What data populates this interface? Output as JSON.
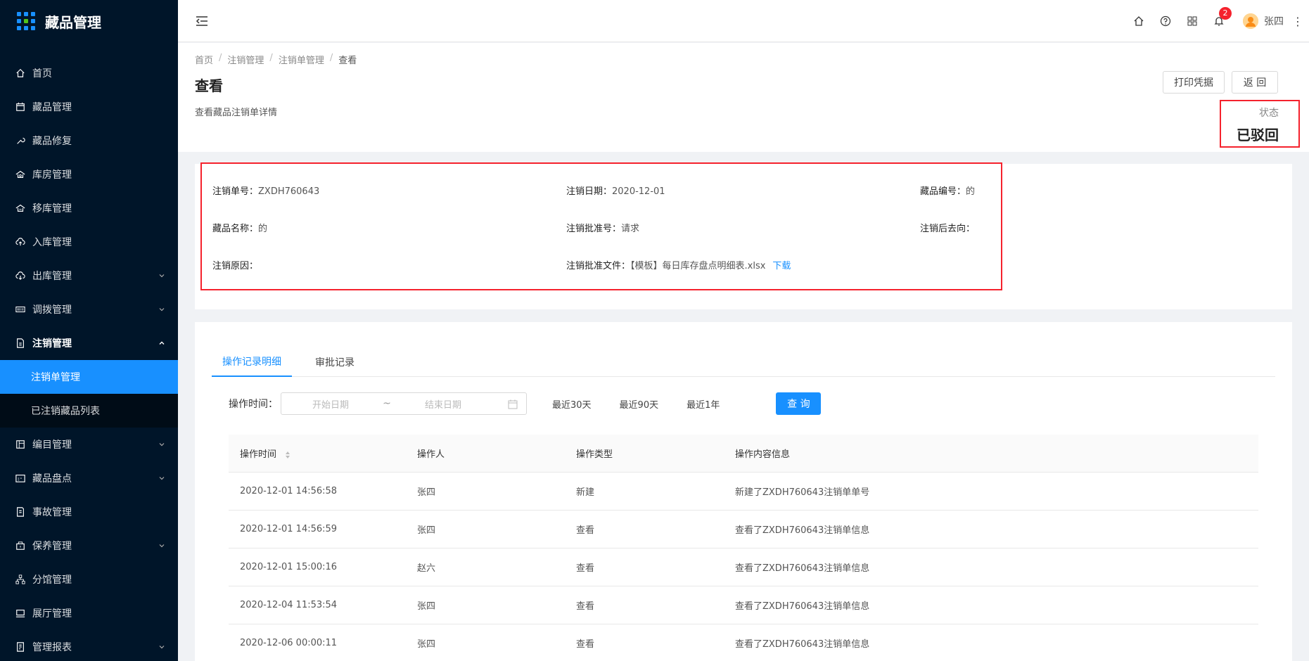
{
  "app": {
    "title": "藏品管理"
  },
  "sidebar": {
    "items": [
      {
        "label": "首页",
        "icon": "home-icon"
      },
      {
        "label": "藏品管理",
        "icon": "calendar-icon"
      },
      {
        "label": "藏品修复",
        "icon": "wrench-icon"
      },
      {
        "label": "库房管理",
        "icon": "warehouse-icon"
      },
      {
        "label": "移库管理",
        "icon": "transfer-icon"
      },
      {
        "label": "入库管理",
        "icon": "cloud-upload-icon"
      },
      {
        "label": "出库管理",
        "icon": "cloud-download-icon"
      },
      {
        "label": "调拨管理",
        "icon": "barcode-icon"
      },
      {
        "label": "注销管理",
        "icon": "file-icon"
      },
      {
        "label": "编目管理",
        "icon": "catalog-icon"
      },
      {
        "label": "藏品盘点",
        "icon": "inventory-icon"
      },
      {
        "label": "事故管理",
        "icon": "incident-icon"
      },
      {
        "label": "保养管理",
        "icon": "maintenance-icon"
      },
      {
        "label": "分馆管理",
        "icon": "branch-icon"
      },
      {
        "label": "展厅管理",
        "icon": "monitor-icon"
      },
      {
        "label": "管理报表",
        "icon": "report-icon"
      }
    ],
    "sub_items": [
      {
        "label": "注销单管理"
      },
      {
        "label": "已注销藏品列表"
      }
    ]
  },
  "header": {
    "notification_count": "2",
    "username": "张四"
  },
  "breadcrumb": [
    "首页",
    "注销管理",
    "注销单管理",
    "查看"
  ],
  "page": {
    "title": "查看",
    "description": "查看藏品注销单详情",
    "print_label": "打印凭据",
    "back_label": "返 回",
    "status_label": "状态",
    "status_value": "已驳回"
  },
  "info": {
    "number_label": "注销单号：",
    "number_value": "ZXDH760643",
    "date_label": "注销日期：",
    "date_value": "2020-12-01",
    "code_label": "藏品编号：",
    "code_value": "的",
    "name_label": "藏品名称：",
    "name_value": "的",
    "approval_label": "注销批准号：",
    "approval_value": "请求",
    "dest_label": "注销后去向：",
    "dest_value": "",
    "reason_label": "注销原因：",
    "reason_value": "",
    "file_label": "注销批准文件：",
    "file_value": "【模板】每日库存盘点明细表.xlsx",
    "download_label": "下载"
  },
  "tabs": [
    {
      "label": "操作记录明细"
    },
    {
      "label": "审批记录"
    }
  ],
  "filter": {
    "label": "操作时间：",
    "start_placeholder": "开始日期",
    "end_placeholder": "结束日期",
    "range_sep": "~",
    "quick1": "最近30天",
    "quick2": "最近90天",
    "quick3": "最近1年",
    "query_label": "查 询"
  },
  "table": {
    "columns": [
      "操作时间",
      "操作人",
      "操作类型",
      "操作内容信息"
    ],
    "rows": [
      [
        "2020-12-01 14:56:58",
        "张四",
        "新建",
        "新建了ZXDH760643注销单单号"
      ],
      [
        "2020-12-01 14:56:59",
        "张四",
        "查看",
        "查看了ZXDH760643注销单信息"
      ],
      [
        "2020-12-01 15:00:16",
        "赵六",
        "查看",
        "查看了ZXDH760643注销单信息"
      ],
      [
        "2020-12-04 11:53:54",
        "张四",
        "查看",
        "查看了ZXDH760643注销单信息"
      ],
      [
        "2020-12-06 00:00:11",
        "张四",
        "查看",
        "查看了ZXDH760643注销单信息"
      ]
    ]
  },
  "colors": {
    "sidebar_bg": "#001529",
    "primary": "#1890ff",
    "highlight_border": "#f5222d"
  }
}
